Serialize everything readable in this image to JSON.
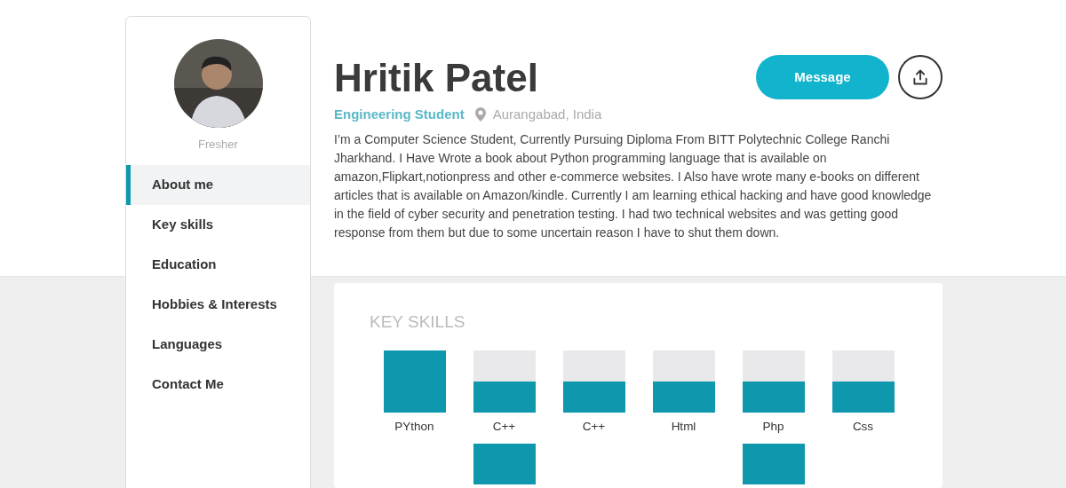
{
  "profile": {
    "status": "Fresher",
    "name": "Hritik Patel",
    "role": "Engineering Student",
    "location": "Aurangabad, India",
    "bio": "I’m a Computer Science Student, Currently Pursuing Diploma From BITT Polytechnic College Ranchi Jharkhand. I Have Wrote a book about Python programming language that is available on amazon,Flipkart,notionpress and other e-commerce websites. I Also have wrote many e-books on different articles that is available on Amazon/kindle. Currently I am learning ethical hacking and have good knowledge in the field of cyber security and penetration testing. I had two technical websites and was getting good response from them but due to some uncertain reason I have to shut them down."
  },
  "actions": {
    "message": "Message"
  },
  "sidebar": {
    "items": [
      {
        "label": "About me",
        "selected": true
      },
      {
        "label": "Key skills",
        "selected": false
      },
      {
        "label": "Education",
        "selected": false
      },
      {
        "label": "Hobbies & Interests",
        "selected": false
      },
      {
        "label": "Languages",
        "selected": false
      },
      {
        "label": "Contact Me",
        "selected": false
      }
    ]
  },
  "key_skills": {
    "title": "KEY SKILLS",
    "skills": [
      {
        "name": "PYthon",
        "kind": "full"
      },
      {
        "name": "C++",
        "kind": "half"
      },
      {
        "name": "C++",
        "kind": "half"
      },
      {
        "name": "Html",
        "kind": "half"
      },
      {
        "name": "Php",
        "kind": "half"
      },
      {
        "name": "Css",
        "kind": "half"
      }
    ],
    "row_2": [
      {
        "kind": "empty"
      },
      {
        "kind": "bar"
      },
      {
        "kind": "empty"
      },
      {
        "kind": "empty"
      },
      {
        "kind": "bar"
      },
      {
        "kind": "empty"
      }
    ]
  }
}
